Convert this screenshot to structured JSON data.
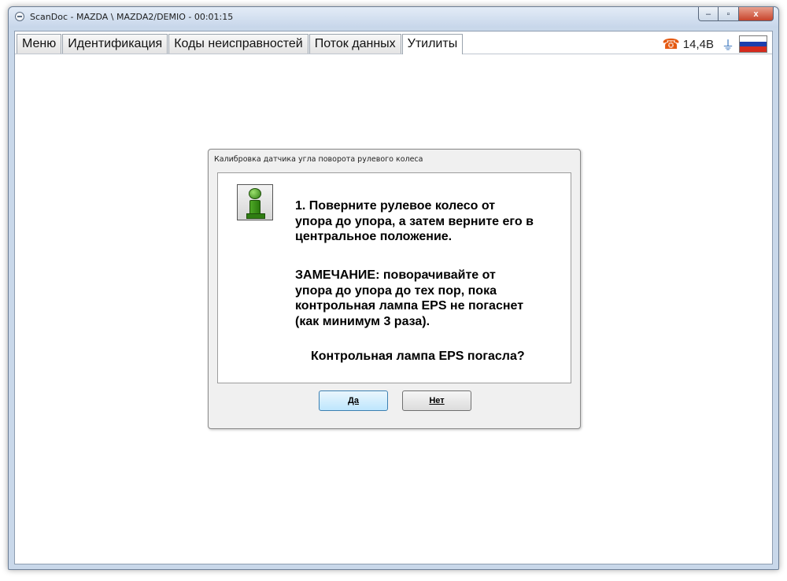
{
  "window": {
    "title": "ScanDoc - MAZDA \\ MAZDA2/DEMIO - 00:01:15",
    "controls": {
      "minimize": "–",
      "maximize": "▫",
      "close": "x"
    }
  },
  "tabs": [
    {
      "label": "Меню"
    },
    {
      "label": "Идентификация"
    },
    {
      "label": "Коды неисправностей"
    },
    {
      "label": "Поток данных"
    },
    {
      "label": "Утилиты",
      "active": true
    }
  ],
  "status": {
    "phone_icon": "phone-icon",
    "voltage": "14,4В",
    "plug_icon": "plug-icon",
    "flag_colors": [
      "#ffffff",
      "#1c3fae",
      "#d52b1e"
    ]
  },
  "dialog": {
    "title": "Калибровка датчика угла поворота рулевого колеса",
    "icon": "info-icon",
    "message_step": "1. Поверните рулевое колесо от\nупора до упора, а затем верните его в\nцентральное положение.",
    "message_note": " ЗАМЕЧАНИЕ: поворачивайте от\nупора до упора до тех пор, пока\nконтрольная лампа EPS не погаснет\n(как минимум 3 раза).",
    "message_question": "Контрольная лампа EPS погасла?",
    "yes_label": "Да",
    "no_label": "Нет"
  }
}
